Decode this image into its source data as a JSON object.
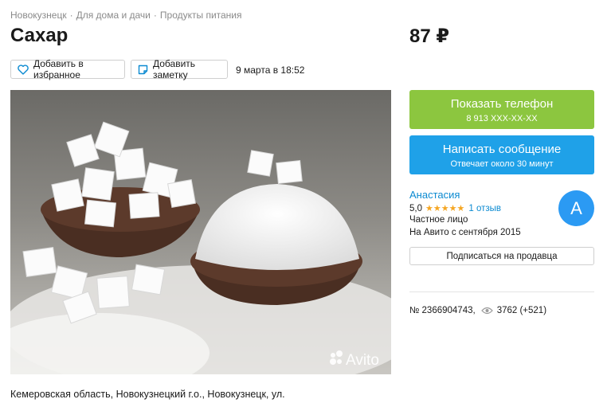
{
  "breadcrumb": [
    "Новокузнецк",
    "Для дома и дачи",
    "Продукты питания"
  ],
  "breadcrumb_separator": "·",
  "title": "Сахар",
  "price": "87 ₽",
  "actions": {
    "favorite_label": "Добавить в избранное",
    "note_label": "Добавить заметку",
    "posted": "9 марта в 18:52"
  },
  "photo": {
    "watermark": "Avito"
  },
  "contact": {
    "phone_label": "Показать телефон",
    "phone_number": "8 913 XXX-XX-XX",
    "message_label": "Написать сообщение",
    "message_sub": "Отвечает около 30 минут"
  },
  "seller": {
    "name": "Анастасия",
    "rating_value": "5,0",
    "rating": 5,
    "reviews": "1 отзыв",
    "type": "Частное лицо",
    "since": "На Авито с сентября 2015",
    "avatar_letter": "А",
    "subscribe_label": "Подписаться на продавца"
  },
  "stats": {
    "ad_number": "№ 2366904743,",
    "views": "3762 (+521)"
  },
  "address": "Кемеровская область, Новокузнецкий г.о., Новокузнецк, ул.",
  "colors": {
    "phone_button": "#8cc63f",
    "message_button": "#1fa1e8",
    "link": "#0b8ad1",
    "star": "#f5a623",
    "avatar": "#2b9af3"
  }
}
